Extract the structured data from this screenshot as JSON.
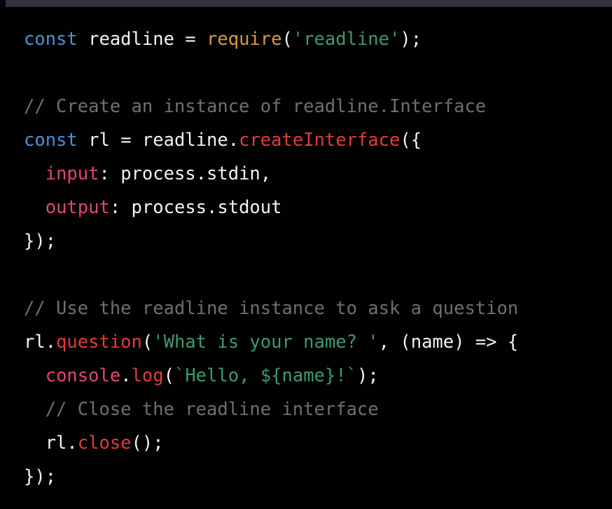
{
  "window": {
    "titlebar_color": "#2f323d",
    "background_color": "#010101"
  },
  "editor": {
    "language": "javascript",
    "theme": "dark",
    "colors": {
      "background": "#010101",
      "foreground": "#f2f2f2",
      "keyword": "#4a90d9",
      "builtin": "#d99a3e",
      "string": "#3d9970",
      "comment": "#6f6f6f",
      "function": "#e03b3b",
      "property": "#e0457b"
    },
    "full_text": "const readline = require('readline');\n\n// Create an instance of readline.Interface\nconst rl = readline.createInterface({\n  input: process.stdin,\n  output: process.stdout\n});\n\n// Use the readline instance to ask a question\nrl.question('What is your name? ', (name) => {\n  console.log(`Hello, ${name}!`);\n  // Close the readline interface\n  rl.close();\n});",
    "lines": [
      {
        "id": "line-1",
        "tokens": [
          {
            "text": "const",
            "type": "keyword"
          },
          {
            "text": " readline ",
            "type": "plain"
          },
          {
            "text": "=",
            "type": "plain"
          },
          {
            "text": " ",
            "type": "plain"
          },
          {
            "text": "require",
            "type": "builtin"
          },
          {
            "text": "(",
            "type": "punct"
          },
          {
            "text": "'readline'",
            "type": "string"
          },
          {
            "text": ");",
            "type": "punct"
          }
        ]
      },
      {
        "id": "line-2",
        "tokens": []
      },
      {
        "id": "line-3",
        "tokens": [
          {
            "text": "// Create an instance of readline.Interface",
            "type": "comment"
          }
        ]
      },
      {
        "id": "line-4",
        "tokens": [
          {
            "text": "const",
            "type": "keyword"
          },
          {
            "text": " rl ",
            "type": "plain"
          },
          {
            "text": "=",
            "type": "plain"
          },
          {
            "text": " readline.",
            "type": "plain"
          },
          {
            "text": "createInterface",
            "type": "function"
          },
          {
            "text": "({",
            "type": "punct"
          }
        ]
      },
      {
        "id": "line-5",
        "tokens": [
          {
            "text": "  ",
            "type": "plain"
          },
          {
            "text": "input",
            "type": "property"
          },
          {
            "text": ": process.stdin,",
            "type": "plain"
          }
        ]
      },
      {
        "id": "line-6",
        "tokens": [
          {
            "text": "  ",
            "type": "plain"
          },
          {
            "text": "output",
            "type": "property"
          },
          {
            "text": ": process.stdout",
            "type": "plain"
          }
        ]
      },
      {
        "id": "line-7",
        "tokens": [
          {
            "text": "});",
            "type": "punct"
          }
        ]
      },
      {
        "id": "line-8",
        "tokens": []
      },
      {
        "id": "line-9",
        "tokens": [
          {
            "text": "// Use the readline instance to ask a question",
            "type": "comment"
          }
        ]
      },
      {
        "id": "line-10",
        "tokens": [
          {
            "text": "rl.",
            "type": "plain"
          },
          {
            "text": "question",
            "type": "function"
          },
          {
            "text": "(",
            "type": "punct"
          },
          {
            "text": "'What is your name? '",
            "type": "string"
          },
          {
            "text": ", (name) => {",
            "type": "plain"
          }
        ]
      },
      {
        "id": "line-11",
        "tokens": [
          {
            "text": "  ",
            "type": "plain"
          },
          {
            "text": "console",
            "type": "property"
          },
          {
            "text": ".",
            "type": "plain"
          },
          {
            "text": "log",
            "type": "function"
          },
          {
            "text": "(",
            "type": "punct"
          },
          {
            "text": "`Hello, ${name}!`",
            "type": "string"
          },
          {
            "text": ");",
            "type": "punct"
          }
        ]
      },
      {
        "id": "line-12",
        "tokens": [
          {
            "text": "  // Close the readline interface",
            "type": "comment"
          }
        ]
      },
      {
        "id": "line-13",
        "tokens": [
          {
            "text": "  rl.",
            "type": "plain"
          },
          {
            "text": "close",
            "type": "function"
          },
          {
            "text": "();",
            "type": "punct"
          }
        ]
      },
      {
        "id": "line-14",
        "tokens": [
          {
            "text": "});",
            "type": "punct"
          }
        ]
      }
    ]
  }
}
